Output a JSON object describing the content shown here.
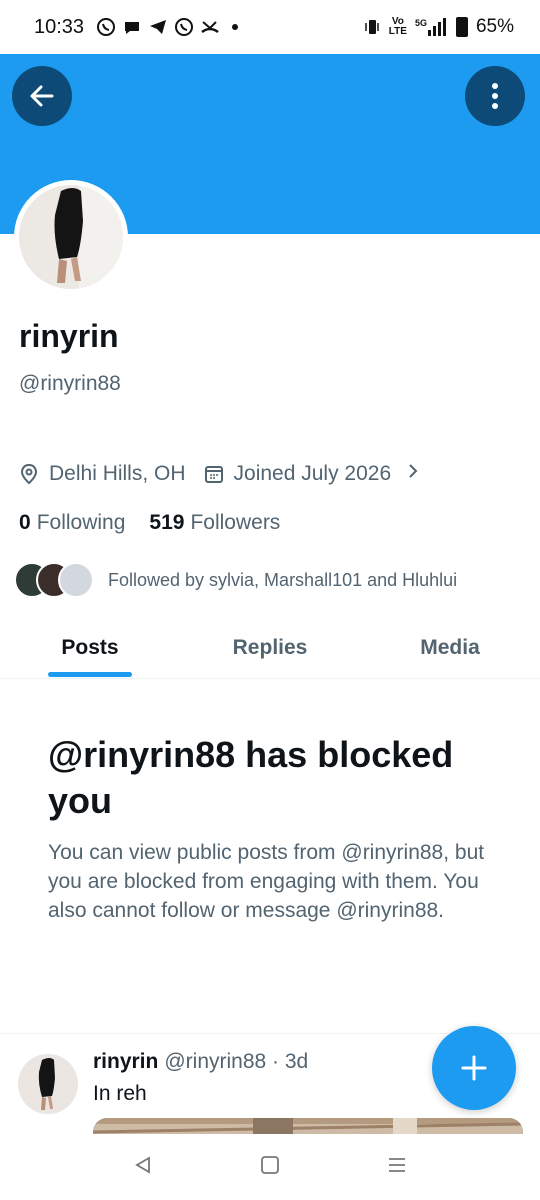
{
  "status_bar": {
    "time": "10:33",
    "network_top": "Vo",
    "network_bottom": "LTE",
    "signal_label": "5G",
    "battery": "65%"
  },
  "profile": {
    "name": "rinyrin",
    "handle": "@rinyrin88",
    "location": "Delhi Hills, OH",
    "joined": "Joined July 2026",
    "following_count": "0",
    "following_label": "Following",
    "followers_count": "519",
    "followers_label": "Followers",
    "followed_by": "Followed by sylvia, Marshall101 and Hluhlui"
  },
  "tabs": [
    {
      "label": "Posts",
      "active": true
    },
    {
      "label": "Replies",
      "active": false
    },
    {
      "label": "Media",
      "active": false
    }
  ],
  "blocked": {
    "title": "@rinyrin88 has blocked you",
    "body": "You can view public posts from @rinyrin88, but you are blocked from engaging with them. You also cannot follow or message @rinyrin88."
  },
  "post": {
    "name": "rinyrin",
    "meta": "@rinyrin88 · 3d",
    "text": "In reh"
  },
  "colors": {
    "accent": "#1d9bf0",
    "banner_button": "#0d4a78",
    "muted_text": "#536471",
    "primary_text": "#0f1419"
  },
  "icons": {
    "back": "arrow-left-icon",
    "more": "vertical-dots-icon",
    "location": "map-pin-icon",
    "calendar": "calendar-icon",
    "expand": "chevron-right-icon",
    "compose": "plus-icon"
  }
}
